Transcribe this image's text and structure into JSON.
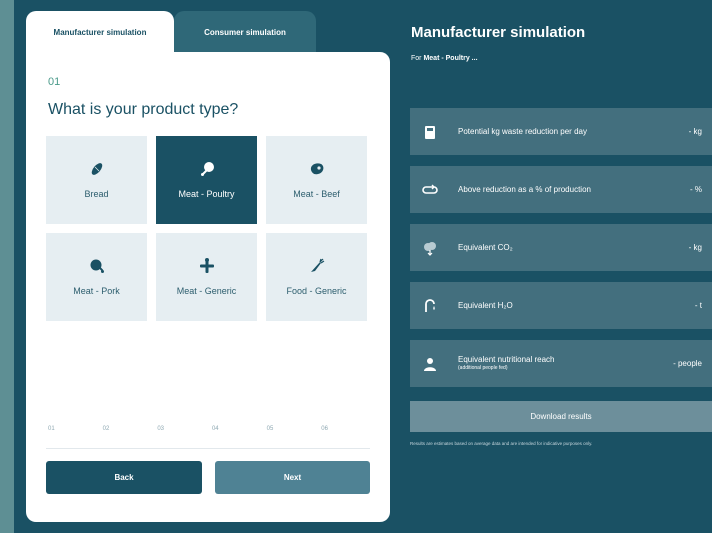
{
  "tabs": [
    {
      "label": "Manufacturer simulation"
    },
    {
      "label": "Consumer simulation"
    }
  ],
  "step": {
    "number": "01",
    "question": "What is your product type?"
  },
  "products": [
    {
      "label": "Bread",
      "icon": "bread-icon"
    },
    {
      "label": "Meat - Poultry",
      "icon": "poultry-icon",
      "selected": true
    },
    {
      "label": "Meat - Beef",
      "icon": "beef-icon"
    },
    {
      "label": "Meat - Pork",
      "icon": "pork-icon"
    },
    {
      "label": "Meat - Generic",
      "icon": "generic-meat-icon"
    },
    {
      "label": "Food - Generic",
      "icon": "carrot-icon"
    }
  ],
  "progress_steps": [
    "01",
    "02",
    "03",
    "04",
    "05",
    "06"
  ],
  "nav": {
    "back_label": "Back",
    "next_label": "Next"
  },
  "results": {
    "title": "Manufacturer simulation",
    "for_prefix": "For",
    "for_value": "Meat - Poultry ...",
    "rows": [
      {
        "icon": "bin-icon",
        "label": "Potential kg waste reduction per day",
        "value": "- kg"
      },
      {
        "icon": "cycle-icon",
        "label": "Above reduction as a % of production",
        "value": "- %"
      },
      {
        "icon": "co2-cloud-icon",
        "label": "Equivalent CO₂",
        "value": "- kg"
      },
      {
        "icon": "water-tap-icon",
        "label": "Equivalent H₂O",
        "value": "- t"
      },
      {
        "icon": "person-icon",
        "label": "Equivalent nutritional reach",
        "sublabel": "(additional people fed)",
        "value": "- people"
      }
    ],
    "download_label": "Download results",
    "footnote": "Results are estimates based on average data and are intended for indicative purposes only."
  },
  "colors": {
    "primary": "#1a5164",
    "panel": "#ffffff",
    "card": "#e6eef2",
    "result_row": "#436f7e",
    "next_button": "#4f8294",
    "accent_step": "#4a9a8a"
  }
}
